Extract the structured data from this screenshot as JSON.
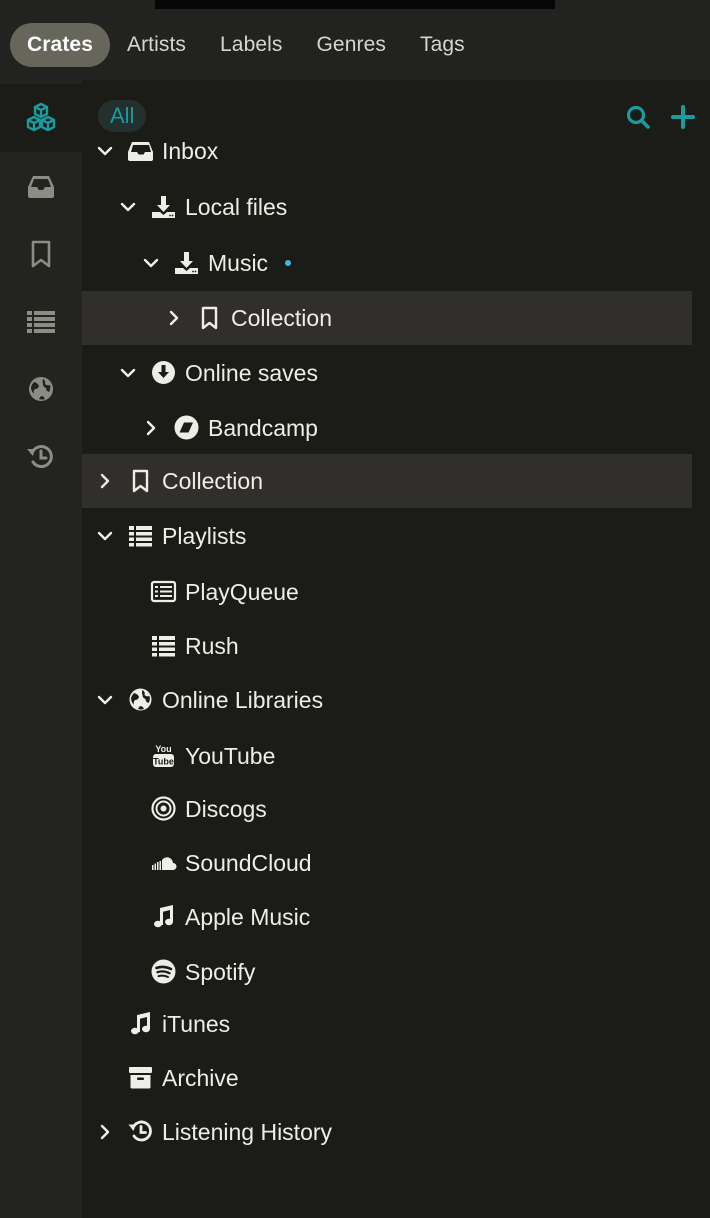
{
  "tabs": [
    {
      "label": "Crates",
      "active": true
    },
    {
      "label": "Artists",
      "active": false
    },
    {
      "label": "Labels",
      "active": false
    },
    {
      "label": "Genres",
      "active": false
    },
    {
      "label": "Tags",
      "active": false
    }
  ],
  "rail": [
    {
      "icon": "cubes-icon",
      "active": true
    },
    {
      "icon": "inbox-icon",
      "active": false
    },
    {
      "icon": "bookmark-icon",
      "active": false
    },
    {
      "icon": "list-icon",
      "active": false
    },
    {
      "icon": "globe-icon",
      "active": false
    },
    {
      "icon": "history-icon",
      "active": false
    }
  ],
  "filter": {
    "label": "All"
  },
  "colors": {
    "accent": "#1a9b9e",
    "dot": "#3fb6e6",
    "selected_row": "#302f2b"
  },
  "tree": [
    {
      "label": "Inbox",
      "icon": "inbox-icon",
      "chevron": "down",
      "selected": false
    },
    {
      "label": "Local files",
      "icon": "download-icon",
      "chevron": "down",
      "selected": false
    },
    {
      "label": "Music",
      "icon": "download-icon",
      "chevron": "down",
      "selected": false,
      "indicator": true
    },
    {
      "label": "Collection",
      "icon": "bookmark-icon",
      "chevron": "right",
      "selected": true
    },
    {
      "label": "Online saves",
      "icon": "circle-download-icon",
      "chevron": "down",
      "selected": false
    },
    {
      "label": "Bandcamp",
      "icon": "bandcamp-icon",
      "chevron": "right",
      "selected": false
    },
    {
      "label": "Collection",
      "icon": "bookmark-icon",
      "chevron": "right",
      "selected": true
    },
    {
      "label": "Playlists",
      "icon": "list-icon",
      "chevron": "down",
      "selected": false
    },
    {
      "label": "PlayQueue",
      "icon": "queue-icon",
      "chevron": "none",
      "selected": false
    },
    {
      "label": "Rush",
      "icon": "list-icon",
      "chevron": "none",
      "selected": false
    },
    {
      "label": "Online Libraries",
      "icon": "globe-icon",
      "chevron": "down",
      "selected": false
    },
    {
      "label": "YouTube",
      "icon": "youtube-icon",
      "chevron": "none",
      "selected": false
    },
    {
      "label": "Discogs",
      "icon": "discogs-icon",
      "chevron": "none",
      "selected": false
    },
    {
      "label": "SoundCloud",
      "icon": "soundcloud-icon",
      "chevron": "none",
      "selected": false
    },
    {
      "label": "Apple Music",
      "icon": "music-note-icon",
      "chevron": "none",
      "selected": false
    },
    {
      "label": "Spotify",
      "icon": "spotify-icon",
      "chevron": "none",
      "selected": false
    },
    {
      "label": "iTunes",
      "icon": "music-note-icon",
      "chevron": "none",
      "selected": false
    },
    {
      "label": "Archive",
      "icon": "archive-icon",
      "chevron": "none",
      "selected": false
    },
    {
      "label": "Listening History",
      "icon": "history-icon",
      "chevron": "right",
      "selected": false
    }
  ]
}
